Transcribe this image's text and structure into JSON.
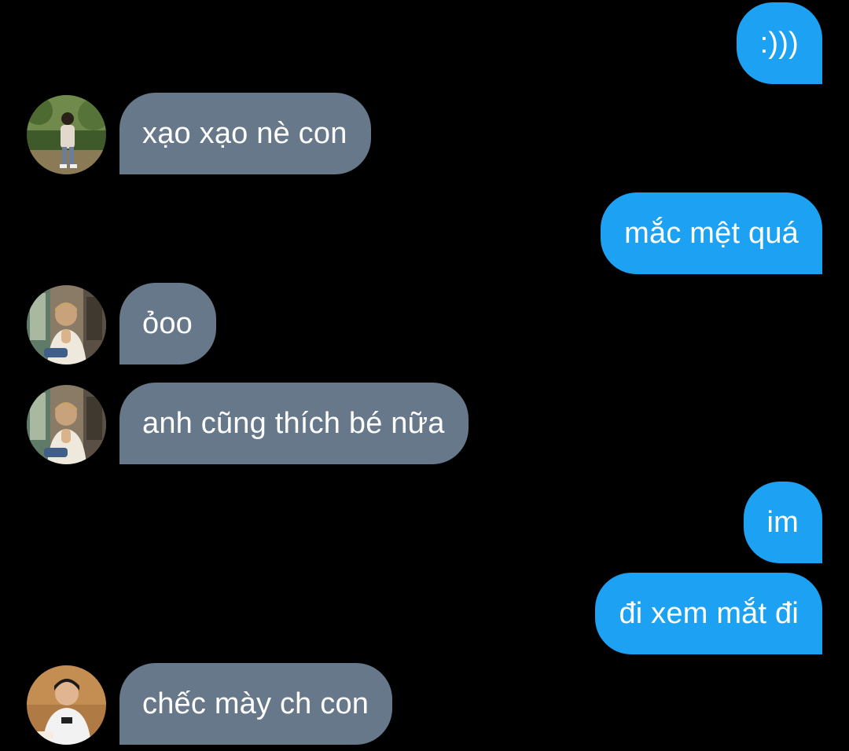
{
  "conversation": {
    "messages": [
      {
        "sender": "self",
        "text": ":)))"
      },
      {
        "sender": "other",
        "text": "xạo xạo nè con",
        "avatar_icon": "person-photo-park-icon"
      },
      {
        "sender": "self",
        "text": "mắc mệt quá"
      },
      {
        "sender": "other",
        "text": "ỏoo",
        "avatar_icon": "person-photo-cafe-icon"
      },
      {
        "sender": "other",
        "text": "anh cũng thích bé nữa",
        "avatar_icon": "person-photo-cafe-icon"
      },
      {
        "sender": "self",
        "text": "im"
      },
      {
        "sender": "self",
        "text": "đi xem mắt đi"
      },
      {
        "sender": "other",
        "text": "chếc mày ch con",
        "avatar_icon": "person-photo-portrait-icon"
      }
    ]
  },
  "colors": {
    "background": "#000000",
    "sent_bubble": "#1da1f2",
    "received_bubble": "#66788a",
    "text": "#ffffff"
  }
}
